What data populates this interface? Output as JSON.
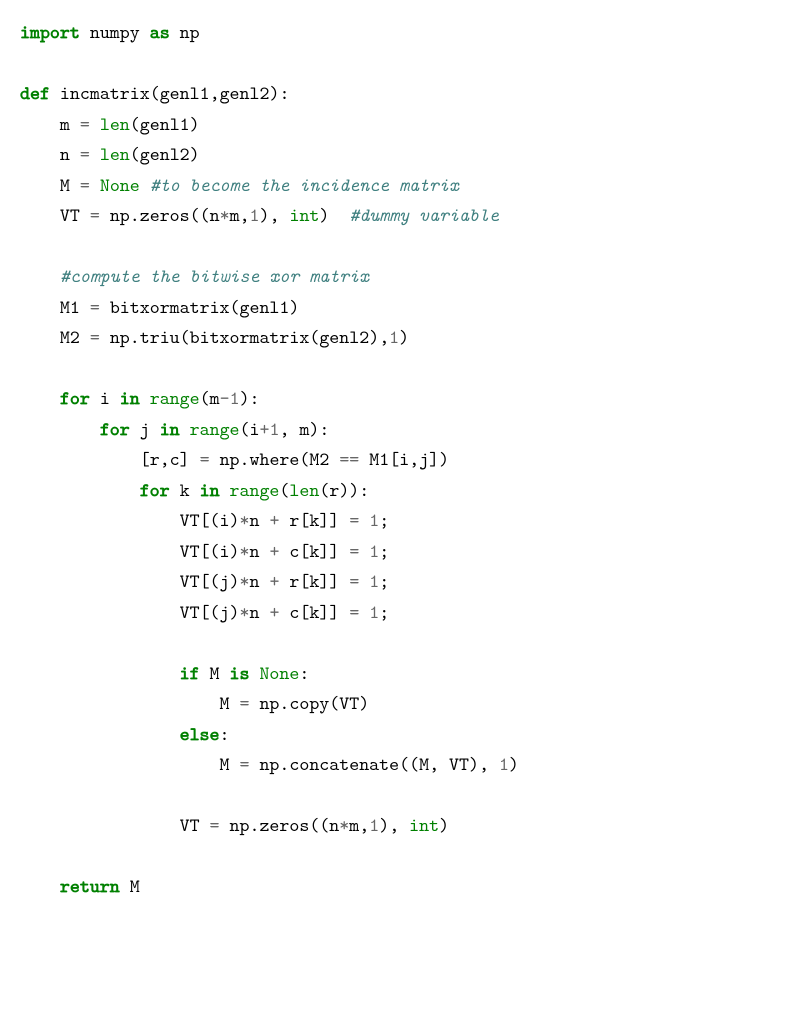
{
  "code": {
    "kw_import": "import",
    "mod_numpy": "numpy",
    "kw_as": "as",
    "alias_np": "np",
    "kw_def": "def",
    "fn_name": "incmatrix",
    "lp": "(",
    "arg_genl1": "genl1",
    "comma": ",",
    "arg_genl2": "genl2",
    "rp": ")",
    "colon": ":",
    "var_m": "m",
    "eq": "=",
    "bi_len": "len",
    "var_n": "n",
    "var_M": "M",
    "kw_None": "None",
    "cm_inc": "#to become the incidence matrix",
    "var_VT": "VT",
    "np_zeros": "np.zeros",
    "arg_nm": "n",
    "star": "*",
    "arg_mm": "m",
    "lit1_zeros": "1",
    "bi_int": "int",
    "cm_dummy": "#dummy variable",
    "cm_bitwise": "#compute the bitwise xor matrix",
    "var_M1": "M1",
    "fn_bxm": "bitxormatrix",
    "var_M2": "M2",
    "np_triu": "np.triu",
    "lit1_triu": "1",
    "kw_for": "for",
    "var_i": "i",
    "kw_in": "in",
    "bi_range": "range",
    "minus": "-",
    "lit1_rng": "1",
    "var_j": "j",
    "plus": "+",
    "lit1_ip1": "1",
    "lb": "[",
    "var_r": "r",
    "var_c": "c",
    "rb": "]",
    "np_where": "np.where",
    "eqeq": "==",
    "var_k": "k",
    "lit1_vt": "1",
    "semi": ";",
    "kw_if": "if",
    "kw_is": "is",
    "np_copy": "np.copy",
    "kw_else": "else",
    "np_concat": "np.concatenate",
    "lit1_cc": "1",
    "kw_return": "return"
  }
}
